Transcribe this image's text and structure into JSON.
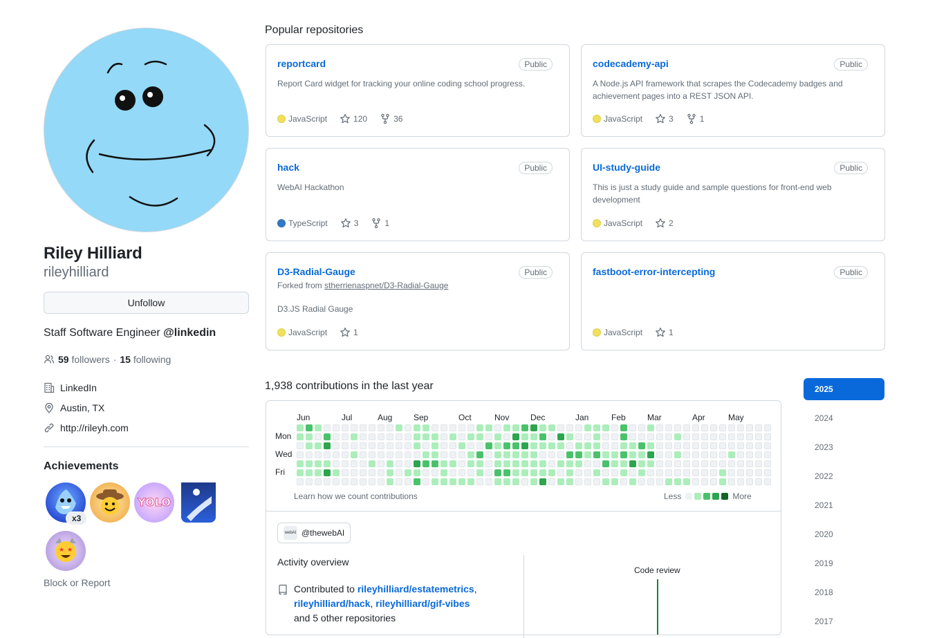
{
  "profile": {
    "name": "Riley Hilliard",
    "login": "rileyhilliard",
    "unfollow_label": "Unfollow",
    "bio_text": "Staff Software Engineer ",
    "bio_org": "@linkedin",
    "followers_count": "59",
    "followers_label": "followers",
    "separator": "·",
    "following_count": "15",
    "following_label": "following",
    "company": "LinkedIn",
    "location": "Austin, TX",
    "website": "http://rileyh.com",
    "achievements_title": "Achievements",
    "achievement_multiplier": "x3",
    "block_report": "Block or Report"
  },
  "popular": {
    "title": "Popular repositories",
    "repos": [
      {
        "name": "reportcard",
        "visibility": "Public",
        "description": "Report Card widget for tracking your online coding school progress.",
        "language": "JavaScript",
        "language_color": "#f1e05a",
        "stars": "120",
        "forks": "36"
      },
      {
        "name": "codecademy-api",
        "visibility": "Public",
        "description": "A Node.js API framework that scrapes the Codecademy badges and achievement pages into a REST JSON API.",
        "language": "JavaScript",
        "language_color": "#f1e05a",
        "stars": "3",
        "forks": "1"
      },
      {
        "name": "hack",
        "visibility": "Public",
        "description": "WebAI Hackathon",
        "language": "TypeScript",
        "language_color": "#3178c6",
        "stars": "3",
        "forks": "1"
      },
      {
        "name": "UI-study-guide",
        "visibility": "Public",
        "description": "This is just a study guide and sample questions for front-end web development",
        "language": "JavaScript",
        "language_color": "#f1e05a",
        "stars": "2"
      },
      {
        "name": "D3-Radial-Gauge",
        "visibility": "Public",
        "fork_prefix": "Forked from ",
        "fork_source": "stherrienaspnet/D3-Radial-Gauge",
        "description": "D3.JS Radial Gauge",
        "language": "JavaScript",
        "language_color": "#f1e05a",
        "stars": "1"
      },
      {
        "name": "fastboot-error-intercepting",
        "visibility": "Public",
        "description": "",
        "language": "JavaScript",
        "language_color": "#f1e05a",
        "stars": "1"
      }
    ]
  },
  "contributions": {
    "title": "1,938 contributions in the last year",
    "months": [
      "Jun",
      "Jul",
      "Aug",
      "Sep",
      "Oct",
      "Nov",
      "Dec",
      "Jan",
      "Feb",
      "Mar",
      "Apr",
      "May"
    ],
    "day_labels": [
      "Mon",
      "Wed",
      "Fri"
    ],
    "learn_link": "Learn how we count contributions",
    "legend_less": "Less",
    "legend_more": "More",
    "level_colors": [
      "#eff2f5",
      "#aceebb",
      "#4ac26b",
      "#2da44e",
      "#116329"
    ],
    "organization": "@thewebAI",
    "org_logo_text": "webAI"
  },
  "activity": {
    "title": "Activity overview",
    "contributed_prefix": "Contributed to ",
    "repo1": "rileyhilliard/estatemetrics",
    "comma": ",",
    "repo2": "rileyhilliard/hack",
    "repo3": "rileyhilliard/gif-vibes",
    "suffix": "and 5 other repositories",
    "chart_label": "Code review"
  },
  "years": [
    "2025",
    "2024",
    "2023",
    "2022",
    "2021",
    "2020",
    "2019",
    "2018",
    "2017"
  ],
  "colors": {
    "accent": "#0969da",
    "avatar_bg": "#94d9f7"
  }
}
